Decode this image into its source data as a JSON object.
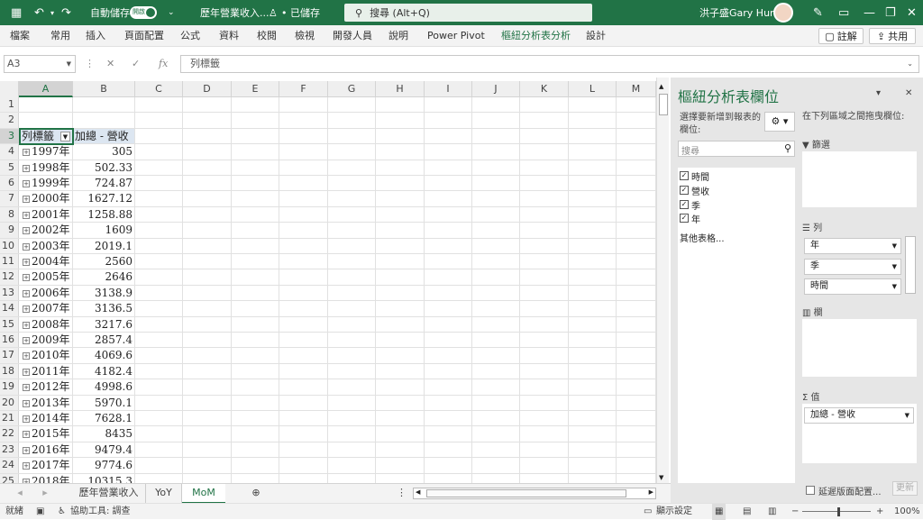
{
  "titlebar": {
    "autosave_label": "自動儲存",
    "autosave_state": "開啟",
    "filename": "歷年營業收入....",
    "saved": "• 已儲存",
    "search_placeholder": "搜尋 (Alt+Q)",
    "user": "洪子盛Gary Hung"
  },
  "menu": {
    "items": [
      "檔案",
      "常用",
      "插入",
      "頁面配置",
      "公式",
      "資料",
      "校閱",
      "檢視",
      "開發人員",
      "說明",
      "Power Pivot",
      "樞紐分析表分析",
      "設計"
    ],
    "comment_label": "註解",
    "share_label": "共用"
  },
  "formula": {
    "namebox": "A3",
    "fx_label": "fx",
    "content": "列標籤"
  },
  "grid": {
    "columns": [
      "A",
      "B",
      "C",
      "D",
      "E",
      "F",
      "G",
      "H",
      "I",
      "J",
      "K",
      "L",
      "M"
    ],
    "header_a": "列標籤",
    "header_b": "加總 - 營收",
    "rows": [
      {
        "year": "1997年",
        "value": "305"
      },
      {
        "year": "1998年",
        "value": "502.33"
      },
      {
        "year": "1999年",
        "value": "724.87"
      },
      {
        "year": "2000年",
        "value": "1627.12"
      },
      {
        "year": "2001年",
        "value": "1258.88"
      },
      {
        "year": "2002年",
        "value": "1609"
      },
      {
        "year": "2003年",
        "value": "2019.1"
      },
      {
        "year": "2004年",
        "value": "2560"
      },
      {
        "year": "2005年",
        "value": "2646"
      },
      {
        "year": "2006年",
        "value": "3138.9"
      },
      {
        "year": "2007年",
        "value": "3136.5"
      },
      {
        "year": "2008年",
        "value": "3217.6"
      },
      {
        "year": "2009年",
        "value": "2857.4"
      },
      {
        "year": "2010年",
        "value": "4069.6"
      },
      {
        "year": "2011年",
        "value": "4182.4"
      },
      {
        "year": "2012年",
        "value": "4998.6"
      },
      {
        "year": "2013年",
        "value": "5970.1"
      },
      {
        "year": "2014年",
        "value": "7628.1"
      },
      {
        "year": "2015年",
        "value": "8435"
      },
      {
        "year": "2016年",
        "value": "9479.4"
      },
      {
        "year": "2017年",
        "value": "9774.6"
      },
      {
        "year": "2018年",
        "value": "10315.3"
      }
    ]
  },
  "sheets": {
    "tabs": [
      "歷年營業收入",
      "YoY",
      "MoM"
    ],
    "active": "MoM"
  },
  "status": {
    "ready": "就緒",
    "accessibility": "協助工具: 調查",
    "display_settings": "顯示設定",
    "zoom": "100%"
  },
  "pane": {
    "title": "樞紐分析表欄位",
    "choose_fields": "選擇要新增到報表的欄位:",
    "search_placeholder": "搜尋",
    "fields": [
      "時間",
      "營收",
      "季",
      "年"
    ],
    "more_tables": "其他表格...",
    "drag_hint": "在下列區域之間拖曳欄位:",
    "filters_label": "篩選",
    "rows_label": "列",
    "columns_label": "欄",
    "values_label": "值",
    "row_fields": [
      "年",
      "季",
      "時間"
    ],
    "value_fields": [
      "加總 - 營收"
    ],
    "defer_label": "延遲版面配置...",
    "update_label": "更新"
  },
  "colors": {
    "accent": "#217346",
    "pivot_header": "#dce6f1"
  }
}
